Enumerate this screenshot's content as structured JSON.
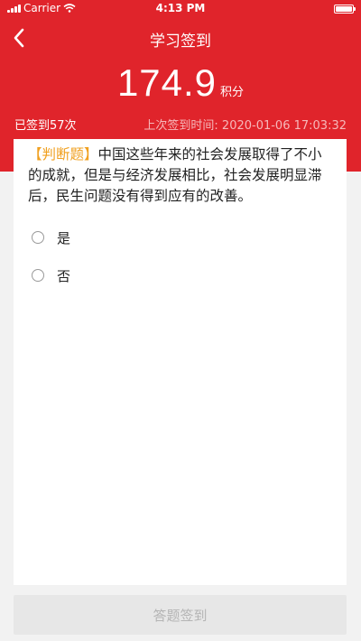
{
  "status_bar": {
    "carrier": "Carrier",
    "time": "4:13 PM",
    "battery_level": 1.0
  },
  "nav": {
    "title": "学习签到",
    "back_icon": "chevron-left-icon"
  },
  "score": {
    "value": "174.9",
    "unit": "积分"
  },
  "signin": {
    "count_text": "已签到57次",
    "last_label": "上次签到时间:",
    "last_time": "2020-01-06 17:03:32"
  },
  "question": {
    "type_label": "【判断题】",
    "text": "中国这些年来的社会发展取得了不小的成就，但是与经济发展相比，社会发展明显滞后，民生问题没有得到应有的改善。",
    "options": [
      "是",
      "否"
    ]
  },
  "submit": {
    "label": "答题签到"
  },
  "colors": {
    "header_red": "#e0242b",
    "question_type": "#f0a020"
  }
}
